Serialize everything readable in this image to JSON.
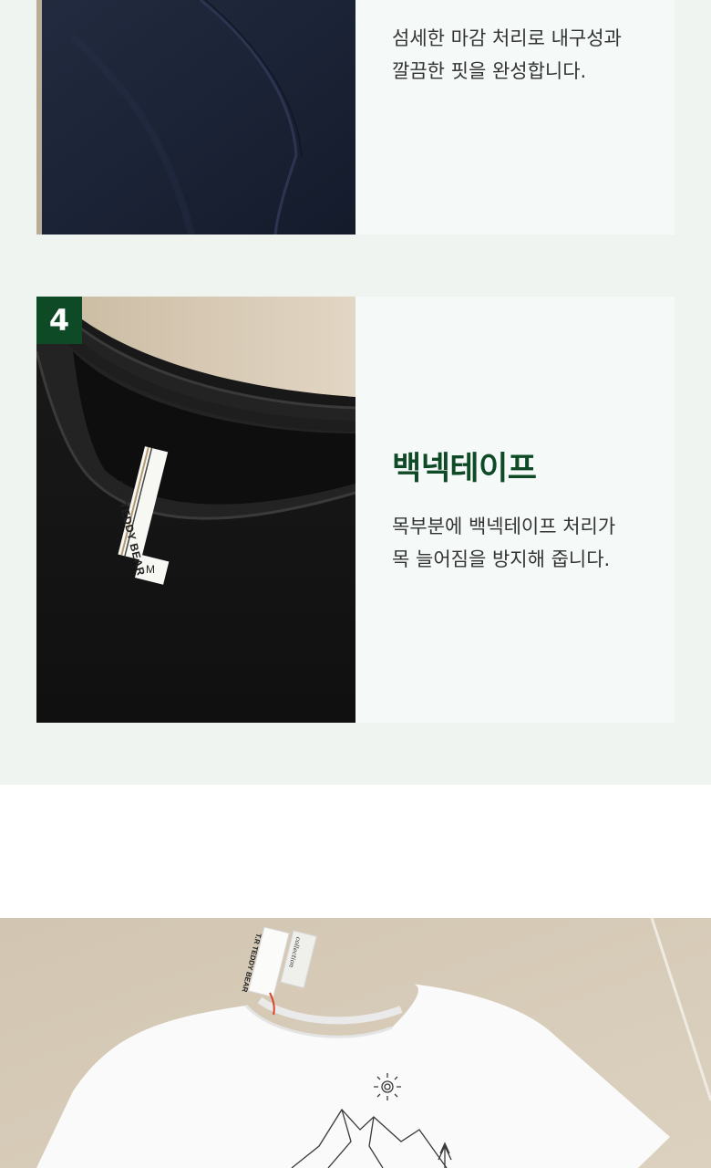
{
  "prev_card": {
    "description": "섬세한 마감 처리로 내구성과\n깔끔한 핏을 완성합니다."
  },
  "feature_4": {
    "number": "4",
    "title": "백넥테이프",
    "description": "목부분에 백넥테이프 처리가\n목 늘어짐을 방지해 줍니다.",
    "label_brand": "T.R TEDDY BEAR",
    "label_size": "M"
  },
  "bottom_photo": {
    "tag_brand": "T.R TEDDY BEAR",
    "tag_sub": "collection"
  },
  "colors": {
    "accent": "#0f4a26",
    "section_bg": "#eff4f1",
    "panel_bg": "#f5f9f8",
    "body_text": "#333333"
  }
}
